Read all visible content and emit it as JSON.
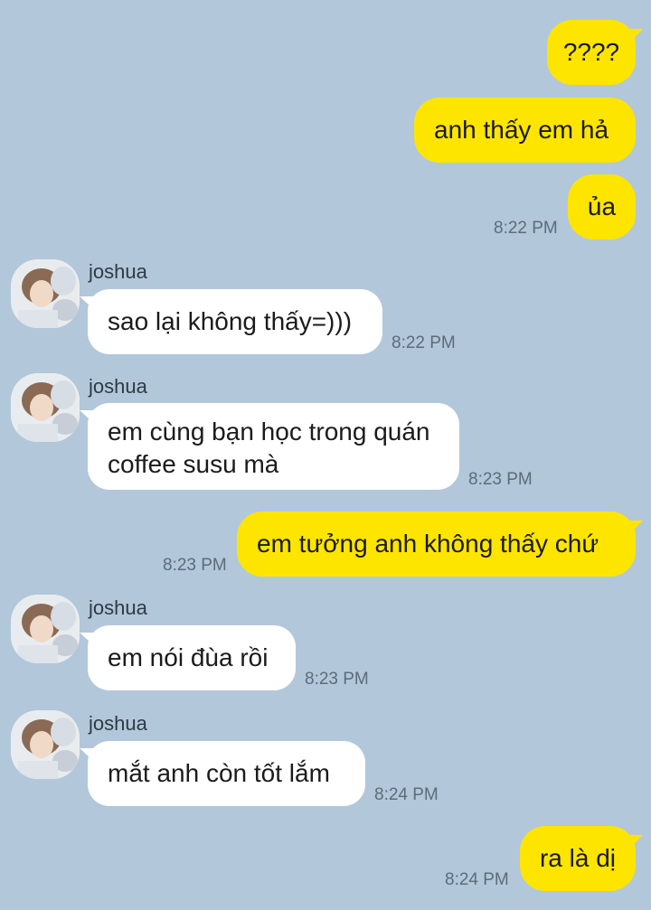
{
  "messages": [
    {
      "text": "????"
    },
    {
      "text": "anh thấy em hả"
    },
    {
      "text": "ủa",
      "time": "8:22 PM"
    },
    {
      "sender": "joshua",
      "text": "sao lại không thấy=)))",
      "time": "8:22 PM"
    },
    {
      "sender": "joshua",
      "text": "em cùng bạn học trong quán coffee susu mà",
      "time": "8:23 PM"
    },
    {
      "text": "em tưởng anh không thấy chứ",
      "time": "8:23 PM"
    },
    {
      "sender": "joshua",
      "text": "em nói đùa rồi",
      "time": "8:23 PM"
    },
    {
      "sender": "joshua",
      "text": "mắt anh còn tốt lắm",
      "time": "8:24 PM"
    },
    {
      "text": "ra là dị",
      "time": "8:24 PM"
    }
  ],
  "colors": {
    "background": "#b2c7da",
    "outgoing_bubble": "#fee500",
    "incoming_bubble": "#ffffff"
  }
}
